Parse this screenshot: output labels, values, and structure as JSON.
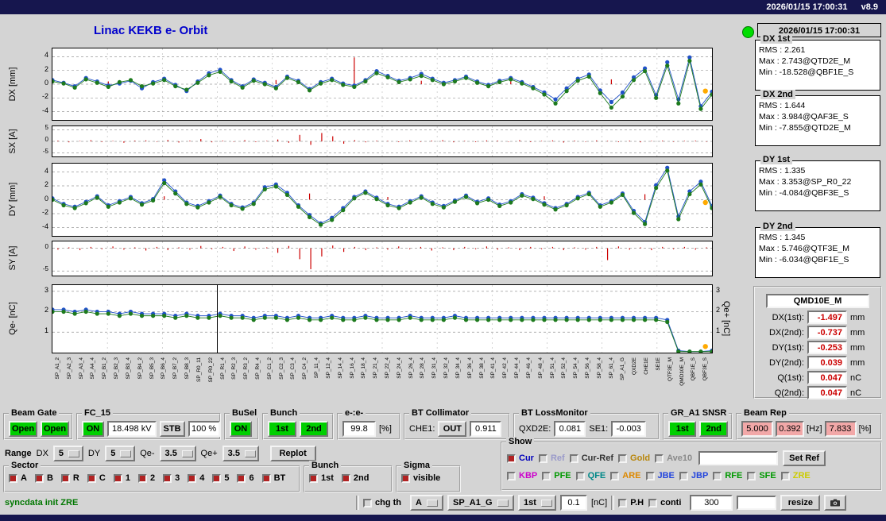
{
  "titlebar": {
    "datetime": "2026/01/15 17:00:31",
    "version": "v8.9"
  },
  "header": {
    "title": "Linac KEKB e- Orbit"
  },
  "status": {
    "timestamp": "2026/01/15 17:00:31",
    "groups": [
      {
        "title": "DX 1st",
        "rms": "RMS : 2.261",
        "max": "Max : 2.743@QTD2E_M",
        "min": "Min : -18.528@QBF1E_S"
      },
      {
        "title": "DX 2nd",
        "rms": "RMS : 1.644",
        "max": "Max : 3.984@QAF3E_S",
        "min": "Min : -7.855@QTD2E_M"
      },
      {
        "title": "DY 1st",
        "rms": "RMS : 1.335",
        "max": "Max : 3.353@SP_R0_22",
        "min": "Min : -4.084@QBF3E_S"
      },
      {
        "title": "DY 2nd",
        "rms": "RMS : 1.345",
        "max": "Max : 5.746@QTF3E_M",
        "min": "Min : -6.034@QBF1E_S"
      }
    ],
    "monitor": {
      "name": "QMD10E_M",
      "rows": [
        {
          "label": "DX(1st):",
          "value": "-1.497",
          "unit": "mm"
        },
        {
          "label": "DX(2nd):",
          "value": "-0.737",
          "unit": "mm"
        },
        {
          "label": "DY(1st):",
          "value": "-0.253",
          "unit": "mm"
        },
        {
          "label": "DY(2nd):",
          "value": "0.039",
          "unit": "mm"
        },
        {
          "label": "Q(1st):",
          "value": "0.047",
          "unit": "nC"
        },
        {
          "label": "Q(2nd):",
          "value": "0.047",
          "unit": "nC"
        }
      ]
    }
  },
  "plots": {
    "ylabels": {
      "dx": "DX [mm]",
      "sx": "SX [A]",
      "dy": "DY [mm]",
      "sy": "SY [A]",
      "qe": "Qe- [nC]",
      "qep": "Qe+ [nC]"
    },
    "xticklabels": [
      "SP_A1_2",
      "SP_A2_3",
      "SP_A3_4",
      "SP_A4_4",
      "SP_B1_2",
      "SP_B2_3",
      "SP_B3_4",
      "SP_B4_2",
      "SP_B5_3",
      "SP_B6_4",
      "SP_B7_2",
      "SP_B8_3",
      "SP_R0_11",
      "SP_R0_22",
      "SP_R1_4",
      "SP_R2_3",
      "SP_R3_2",
      "SP_R4_4",
      "SP_C1_2",
      "SP_C2_3",
      "SP_C3_4",
      "SP_C4_2",
      "SP_11_4",
      "SP_12_4",
      "SP_14_4",
      "SP_16_4",
      "SP_18_4",
      "SP_21_4",
      "SP_22_4",
      "SP_24_4",
      "SP_26_4",
      "SP_28_4",
      "SP_31_4",
      "SP_32_4",
      "SP_34_4",
      "SP_36_4",
      "SP_38_4",
      "SP_41_4",
      "SP_42_4",
      "SP_44_4",
      "SP_46_4",
      "SP_48_4",
      "SP_51_4",
      "SP_52_4",
      "SP_54_4",
      "SP_56_4",
      "SP_58_4",
      "SP_61_4",
      "SP_A1_G",
      "QXD2E",
      "CHE1E",
      "SE1E",
      "QTF3E_M",
      "QMD10E_M",
      "QBF1E_S",
      "QBF3E_S"
    ]
  },
  "chart_data": [
    {
      "id": "dx",
      "type": "scatter",
      "title": "DX orbit",
      "ylabel": "DX [mm]",
      "ylim": [
        -5.2,
        5.2
      ],
      "yticks": [
        4,
        2,
        0,
        -2,
        -4
      ],
      "tick_size": 9,
      "grid": true,
      "series": [
        {
          "name": "Cur 1st bunch",
          "color": "#2152c8",
          "values": [
            0.6,
            0.2,
            -0.3,
            0.9,
            0.4,
            -0.2,
            0.1,
            0.5,
            -0.6,
            0.3,
            0.8,
            -0.1,
            -1.0,
            0.4,
            1.6,
            2.1,
            0.6,
            -0.3,
            0.7,
            0.2,
            -0.4,
            1.1,
            0.5,
            -0.7,
            0.3,
            0.8,
            0.1,
            -0.2,
            0.6,
            1.9,
            1.2,
            0.5,
            0.9,
            1.5,
            0.8,
            0.2,
            0.6,
            1.1,
            0.4,
            -0.1,
            0.5,
            0.9,
            0.3,
            -0.4,
            -1.2,
            -2.2,
            -0.6,
            0.8,
            1.4,
            -0.9,
            -2.6,
            -1.2,
            1.0,
            2.3,
            -1.6,
            3.2,
            -2.2,
            3.9,
            -3.2,
            -1.1
          ]
        },
        {
          "name": "Cur 2nd bunch",
          "color": "#1d7a1d",
          "values": [
            0.4,
            0.1,
            -0.5,
            0.7,
            0.2,
            -0.4,
            0.3,
            0.6,
            -0.3,
            0.1,
            0.6,
            -0.3,
            -0.8,
            0.2,
            1.3,
            1.8,
            0.4,
            -0.5,
            0.5,
            0.0,
            -0.6,
            0.9,
            0.3,
            -0.9,
            0.1,
            0.6,
            -0.1,
            -0.4,
            0.4,
            1.6,
            1.0,
            0.3,
            0.7,
            1.2,
            0.6,
            0.0,
            0.4,
            0.9,
            0.2,
            -0.3,
            0.3,
            0.7,
            0.1,
            -0.6,
            -1.5,
            -2.8,
            -1.0,
            0.5,
            1.1,
            -1.3,
            -3.4,
            -1.8,
            0.6,
            1.9,
            -2.0,
            2.7,
            -2.8,
            3.4,
            -3.6,
            -1.5
          ]
        }
      ],
      "bars_pairs": [
        [
          5,
          0.4
        ],
        [
          13,
          0.5
        ],
        [
          20,
          0.6
        ],
        [
          27,
          3.9
        ],
        [
          33,
          0.5
        ],
        [
          41,
          0.4
        ],
        [
          50,
          0.7
        ]
      ],
      "bars_color": "#cc0000",
      "markers": [
        [
          0.99,
          -1.0
        ]
      ],
      "marker_color": "#ffaa00"
    },
    {
      "id": "sx",
      "type": "bar",
      "title": "SX steering",
      "ylabel": "SX [A]",
      "ylim": [
        -6.5,
        6.5
      ],
      "yticks": [
        5,
        0,
        -5
      ],
      "tick_size": 8,
      "grid": true,
      "bars_color": "#cc0000",
      "bars": [
        0.3,
        -0.4,
        0.2,
        0.5,
        -0.3,
        0.2,
        -0.6,
        0.3,
        0.4,
        -0.2,
        0.6,
        -0.5,
        0.3,
        1.0,
        -0.4,
        0.3,
        -0.2,
        0.5,
        -0.3,
        0.2,
        0.8,
        -0.6,
        2.8,
        -1.5,
        3.6,
        2.2,
        -1.0,
        0.5,
        -0.4,
        0.3,
        0.2,
        -0.3,
        0.4,
        -0.2,
        0.3,
        0.5,
        -0.4,
        0.2,
        -0.3,
        0.4,
        0.3,
        -0.2,
        0.5,
        -0.3,
        0.2,
        0.4,
        -0.5,
        0.3,
        -0.2,
        0.4,
        0.2,
        -0.3,
        0.3,
        -0.4,
        0.2,
        0.3,
        -0.2,
        0.2,
        0.3,
        -0.2
      ]
    },
    {
      "id": "dy",
      "type": "scatter",
      "title": "DY orbit",
      "ylabel": "DY [mm]",
      "ylim": [
        -5.2,
        5.2
      ],
      "yticks": [
        4,
        2,
        0,
        -2,
        -4
      ],
      "tick_size": 9,
      "grid": true,
      "series": [
        {
          "name": "Cur 1st bunch",
          "color": "#2152c8",
          "values": [
            0.2,
            -0.6,
            -1.0,
            -0.3,
            0.5,
            -0.8,
            -0.2,
            0.4,
            -0.5,
            0.1,
            2.8,
            1.2,
            -0.4,
            -0.9,
            -0.2,
            0.6,
            -0.6,
            -1.1,
            -0.4,
            1.8,
            2.2,
            1.0,
            -0.8,
            -2.2,
            -3.4,
            -2.6,
            -1.2,
            0.4,
            1.2,
            0.3,
            -0.6,
            -1.0,
            -0.2,
            0.5,
            -0.4,
            -0.9,
            -0.1,
            0.6,
            -0.3,
            0.2,
            -0.7,
            -0.2,
            0.8,
            0.3,
            -0.5,
            -1.2,
            -0.6,
            0.4,
            1.0,
            -0.8,
            -0.2,
            0.9,
            -1.6,
            -3.2,
            2.1,
            4.6,
            -2.4,
            1.2,
            2.6,
            -0.9
          ]
        },
        {
          "name": "Cur 2nd bunch",
          "color": "#1d7a1d",
          "values": [
            0.0,
            -0.8,
            -1.2,
            -0.5,
            0.3,
            -1.0,
            -0.4,
            0.2,
            -0.7,
            -0.1,
            2.4,
            0.9,
            -0.6,
            -1.1,
            -0.4,
            0.4,
            -0.8,
            -1.3,
            -0.6,
            1.5,
            1.9,
            0.7,
            -1.0,
            -2.5,
            -3.6,
            -2.9,
            -1.5,
            0.2,
            1.0,
            0.1,
            -0.8,
            -1.2,
            -0.4,
            0.3,
            -0.6,
            -1.1,
            -0.3,
            0.4,
            -0.5,
            0.0,
            -0.9,
            -0.4,
            0.6,
            0.1,
            -0.7,
            -1.4,
            -0.8,
            0.2,
            0.8,
            -1.0,
            -0.4,
            0.7,
            -1.9,
            -3.5,
            1.7,
            4.2,
            -2.8,
            0.8,
            2.2,
            -1.2
          ]
        }
      ],
      "bars_pairs": [
        [
          10,
          0.5
        ],
        [
          23,
          0.9
        ],
        [
          30,
          0.4
        ],
        [
          44,
          0.5
        ],
        [
          53,
          0.8
        ]
      ],
      "bars_color": "#cc0000",
      "markers": [
        [
          0.99,
          -0.4
        ]
      ],
      "marker_color": "#ffaa00"
    },
    {
      "id": "sy",
      "type": "bar",
      "title": "SY steering",
      "ylabel": "SY [A]",
      "ylim": [
        -6.0,
        1.5
      ],
      "yticks": [
        0,
        -5
      ],
      "tick_size": 8,
      "grid": true,
      "bars_color": "#cc0000",
      "bars": [
        -0.3,
        0.2,
        -0.4,
        0.3,
        -0.2,
        0.4,
        -0.3,
        0.2,
        -0.5,
        0.3,
        -0.4,
        0.2,
        -0.3,
        0.5,
        -0.2,
        0.3,
        -0.6,
        0.4,
        -0.3,
        0.2,
        -1.0,
        0.5,
        -2.4,
        -4.6,
        -1.8,
        0.6,
        -0.8,
        0.3,
        -0.4,
        0.2,
        -0.3,
        0.4,
        -0.2,
        0.3,
        -0.5,
        0.2,
        -0.4,
        0.3,
        -0.2,
        0.4,
        -0.3,
        0.2,
        -0.4,
        0.3,
        -0.2,
        0.3,
        -0.4,
        0.2,
        -0.3,
        0.3,
        -2.6,
        0.4,
        -0.3,
        0.2,
        -0.4,
        0.3,
        -0.2,
        0.3,
        -0.3,
        0.2
      ]
    },
    {
      "id": "qe",
      "type": "scatter",
      "title": "Bunch charge",
      "ylabel": "Qe- [nC]",
      "ylabel_right": "Qe+ [nC]",
      "ylim": [
        0,
        3.3
      ],
      "yticks": [
        3,
        2,
        1
      ],
      "tick_size": 9,
      "right_ticks": true,
      "grid": true,
      "series": [
        {
          "name": "Qe 1st bunch",
          "color": "#2152c8",
          "values": [
            2.1,
            2.1,
            2.0,
            2.1,
            2.0,
            2.0,
            1.9,
            2.0,
            1.9,
            1.9,
            1.9,
            1.8,
            1.9,
            1.8,
            1.8,
            1.9,
            1.8,
            1.8,
            1.7,
            1.8,
            1.8,
            1.7,
            1.8,
            1.7,
            1.7,
            1.8,
            1.7,
            1.7,
            1.8,
            1.7,
            1.7,
            1.7,
            1.8,
            1.7,
            1.7,
            1.7,
            1.8,
            1.7,
            1.7,
            1.7,
            1.7,
            1.7,
            1.7,
            1.7,
            1.7,
            1.7,
            1.7,
            1.7,
            1.7,
            1.7,
            1.7,
            1.7,
            1.7,
            1.7,
            1.7,
            1.6,
            0.1,
            0.05,
            0.05,
            0.1
          ]
        },
        {
          "name": "Qe 2nd bunch",
          "color": "#1d7a1d",
          "values": [
            2.0,
            2.0,
            1.9,
            2.0,
            1.9,
            1.9,
            1.8,
            1.9,
            1.8,
            1.8,
            1.8,
            1.7,
            1.8,
            1.7,
            1.7,
            1.8,
            1.7,
            1.7,
            1.6,
            1.7,
            1.7,
            1.6,
            1.7,
            1.6,
            1.6,
            1.7,
            1.6,
            1.6,
            1.7,
            1.6,
            1.6,
            1.6,
            1.7,
            1.6,
            1.6,
            1.6,
            1.7,
            1.6,
            1.6,
            1.6,
            1.6,
            1.6,
            1.6,
            1.6,
            1.6,
            1.6,
            1.6,
            1.6,
            1.6,
            1.6,
            1.6,
            1.6,
            1.6,
            1.6,
            1.6,
            1.5,
            0.05,
            0.05,
            0.05,
            0.05
          ]
        }
      ],
      "markers": [
        [
          0.99,
          0.3
        ]
      ],
      "marker_color": "#ffaa00",
      "cursor": 0.25
    }
  ],
  "panels": {
    "beam_gate": {
      "title": "Beam Gate",
      "buttons": [
        "Open",
        "Open"
      ]
    },
    "fc15": {
      "title": "FC_15",
      "on": "ON",
      "kv": "18.498 kV",
      "stb": "STB",
      "pct": "100 %"
    },
    "busel": {
      "title": "BuSel",
      "on": "ON"
    },
    "bunch": {
      "title": "Bunch",
      "b1": "1st",
      "b2": "2nd"
    },
    "ee": {
      "title": "e-:e-",
      "value": "99.8",
      "unit": "[%]"
    },
    "bt_collimator": {
      "title": "BT Collimator",
      "che1_label": "CHE1:",
      "che1_state": "OUT",
      "value": "0.911"
    },
    "bt_lossmonitor": {
      "title": "BT LossMonitor",
      "qxd2e_label": "QXD2E:",
      "qxd2e": "0.081",
      "se1_label": "SE1:",
      "se1": "-0.003"
    },
    "gr_a1": {
      "title": "GR_A1 SNSR",
      "b1": "1st",
      "b2": "2nd"
    },
    "beam_rep": {
      "title": "Beam Rep",
      "v1": "5.000",
      "v2": "0.392",
      "hz": "[Hz]",
      "v3": "7.833",
      "pct": "[%]"
    }
  },
  "range_row": {
    "range_label": "Range",
    "dx_label": "DX",
    "dx": "5",
    "dy_label": "DY",
    "dy": "5",
    "qem_label": "Qe-",
    "qem": "3.5",
    "qep_label": "Qe+",
    "qep": "3.5",
    "replot": "Replot"
  },
  "sector": {
    "title": "Sector",
    "items": [
      {
        "label": "A",
        "checked": true
      },
      {
        "label": "B",
        "checked": true
      },
      {
        "label": "R",
        "checked": true
      },
      {
        "label": "C",
        "checked": true
      },
      {
        "label": "1",
        "checked": true
      },
      {
        "label": "2",
        "checked": true
      },
      {
        "label": "3",
        "checked": true
      },
      {
        "label": "4",
        "checked": true
      },
      {
        "label": "5",
        "checked": true
      },
      {
        "label": "6",
        "checked": true
      },
      {
        "label": "BT",
        "checked": true
      }
    ]
  },
  "bunch_sel": {
    "title": "Bunch",
    "items": [
      {
        "label": "1st",
        "checked": true
      },
      {
        "label": "2nd",
        "checked": true
      }
    ]
  },
  "sigma": {
    "title": "Sigma",
    "items": [
      {
        "label": "visible",
        "checked": true
      }
    ]
  },
  "show": {
    "title": "Show",
    "row1": [
      {
        "label": "Cur",
        "checked": true,
        "color": "#0000bb"
      },
      {
        "label": "Ref",
        "checked": false,
        "color": "#9a9aca"
      },
      {
        "label": "Cur-Ref",
        "checked": false,
        "color": "#333333"
      },
      {
        "label": "Gold",
        "checked": false,
        "color": "#b8860b"
      },
      {
        "label": "Ave10",
        "checked": false,
        "color": "#8a8a8a"
      }
    ],
    "ref_input": "",
    "set_ref": "Set Ref",
    "row2": [
      {
        "label": "KBP",
        "checked": false,
        "color": "#cc00cc"
      },
      {
        "label": "PFE",
        "checked": false,
        "color": "#009900"
      },
      {
        "label": "QFE",
        "checked": false,
        "color": "#008888"
      },
      {
        "label": "ARE",
        "checked": false,
        "color": "#dd8800"
      },
      {
        "label": "JBE",
        "checked": false,
        "color": "#2244dd"
      },
      {
        "label": "JBP",
        "checked": false,
        "color": "#2244dd"
      },
      {
        "label": "RFE",
        "checked": false,
        "color": "#009900"
      },
      {
        "label": "SFE",
        "checked": false,
        "color": "#009900"
      },
      {
        "label": "ZRE",
        "checked": false,
        "color": "#cccc00"
      }
    ]
  },
  "bottom": {
    "status": "syncdata init ZRE",
    "chg_th": [
      {
        "label": "chg th",
        "checked": false
      }
    ],
    "dd_a": "A",
    "dd_sp": "SP_A1_G",
    "dd_1st": "1st",
    "thr": "0.1",
    "thr_unit": "[nC]",
    "checks2": [
      {
        "label": "P.H",
        "checked": false
      },
      {
        "label": "conti",
        "checked": false
      }
    ],
    "dd_300": "300",
    "extra": "",
    "resize": "resize"
  },
  "colors": {
    "accent_green": "#00cf00",
    "pink_field": "#f2a8a8",
    "cur_blue": "#2152c8",
    "bunch2_green": "#1d7a1d",
    "sigma_red": "#cc0000",
    "marker_orange": "#ffaa00"
  }
}
